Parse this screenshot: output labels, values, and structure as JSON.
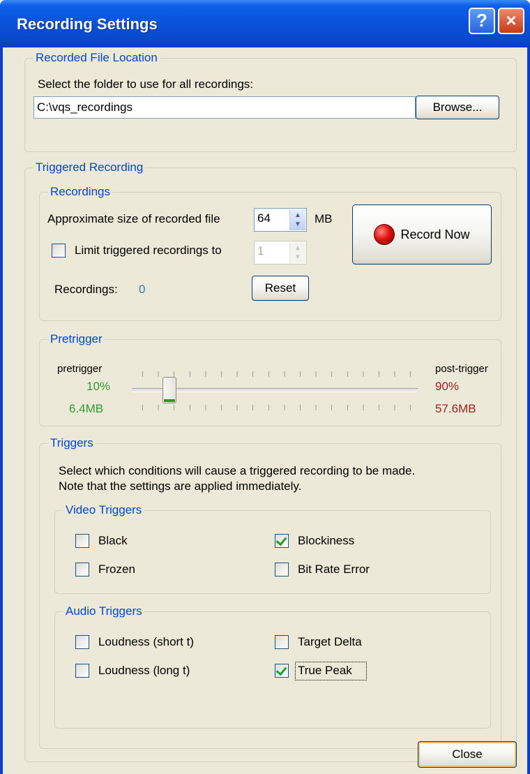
{
  "window": {
    "title": "Recording Settings",
    "help_glyph": "?",
    "close_glyph": "×"
  },
  "file_location": {
    "group_label": "Recorded File Location",
    "prompt": "Select the folder to use for all recordings:",
    "path_value": "C:\\vqs_recordings",
    "browse_label": "Browse..."
  },
  "triggered": {
    "group_label": "Triggered Recording",
    "recordings": {
      "group_label": "Recordings",
      "size_label": "Approximate size of recorded file",
      "size_value": "64",
      "size_unit": "MB",
      "limit_label": "Limit triggered recordings to",
      "limit_checked": false,
      "limit_value": "1",
      "count_label": "Recordings:",
      "count_value": "0",
      "reset_label": "Reset",
      "record_now_label": "Record Now"
    },
    "pretrigger": {
      "group_label": "Pretrigger",
      "left_heading": "pretrigger",
      "right_heading": "post-trigger",
      "pre_percent": "10%",
      "post_percent": "90%",
      "pre_size": "6.4MB",
      "post_size": "57.6MB",
      "slider_fraction": 0.1
    },
    "triggers": {
      "group_label": "Triggers",
      "desc_line1": "Select which conditions will cause a triggered recording to be made.",
      "desc_line2": "Note that the settings are applied immediately.",
      "video": {
        "group_label": "Video Triggers",
        "items": [
          {
            "label": "Black",
            "checked": false
          },
          {
            "label": "Blockiness",
            "checked": true
          },
          {
            "label": "Frozen",
            "checked": false
          },
          {
            "label": "Bit Rate Error",
            "checked": false
          }
        ]
      },
      "audio": {
        "group_label": "Audio Triggers",
        "items": [
          {
            "label": "Loudness (short t)",
            "checked": false
          },
          {
            "label": "Target Delta",
            "checked": false
          },
          {
            "label": "Loudness (long t)",
            "checked": false
          },
          {
            "label": "True Peak",
            "checked": true
          }
        ]
      }
    }
  },
  "close_label": "Close",
  "colors": {
    "accent": "#0046d5",
    "pre": "#2e9a2e",
    "post": "#9a1f1f",
    "count": "#2f7fb0"
  }
}
